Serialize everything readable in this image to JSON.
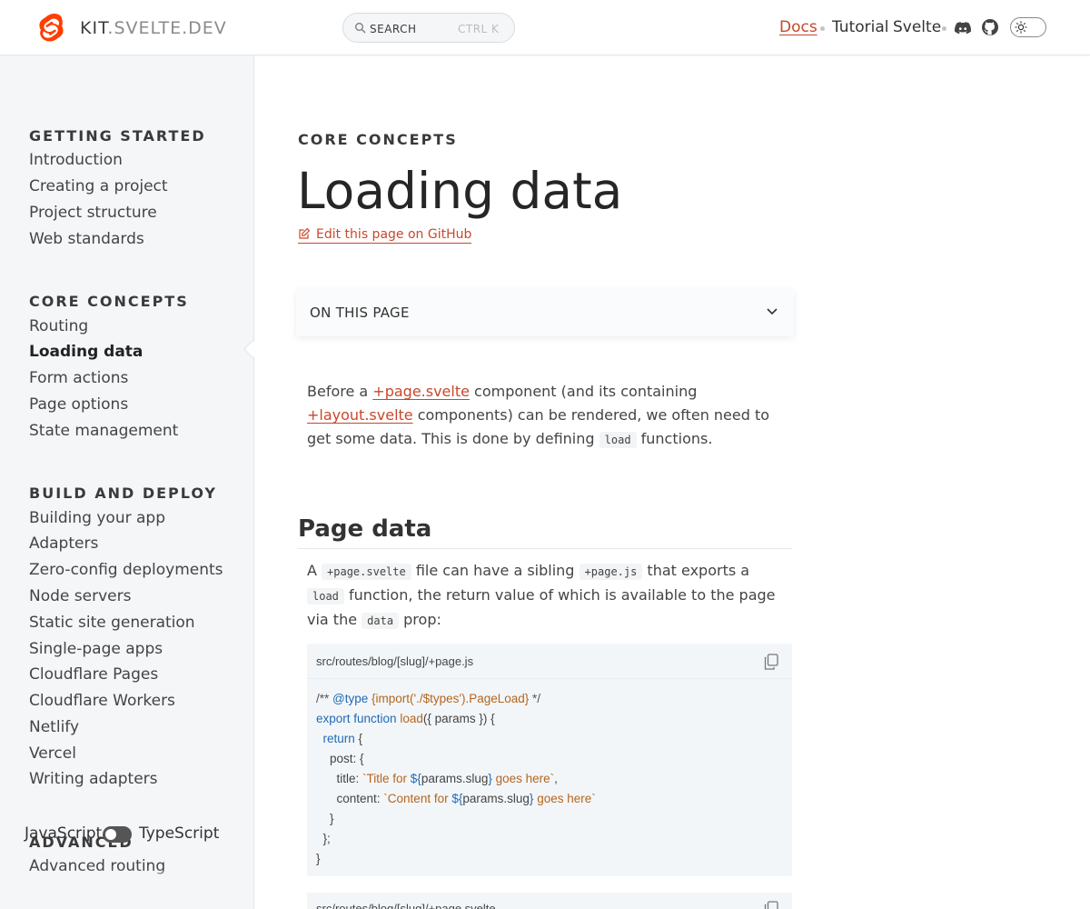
{
  "header": {
    "brand_main": "KIT",
    "brand_dim": ".SVELTE.DEV",
    "search_label": "SEARCH",
    "search_shortcut": "CTRL  K",
    "nav": [
      {
        "label": "Docs",
        "active": true
      },
      {
        "label": "Tutorial",
        "active": false
      },
      {
        "label": "Svelte",
        "active": false
      }
    ],
    "icons": [
      "discord-icon",
      "github-icon",
      "sun-icon"
    ],
    "accent_color": "#c9472a"
  },
  "sidebar": {
    "sections": [
      {
        "title": "GETTING STARTED",
        "items": [
          "Introduction",
          "Creating a project",
          "Project structure",
          "Web standards"
        ]
      },
      {
        "title": "CORE CONCEPTS",
        "items": [
          "Routing",
          "Loading data",
          "Form actions",
          "Page options",
          "State management"
        ]
      },
      {
        "title": "BUILD AND DEPLOY",
        "items": [
          "Building your app",
          "Adapters",
          "Zero-config deployments",
          "Node servers",
          "Static site generation",
          "Single-page apps",
          "Cloudflare Pages",
          "Cloudflare Workers",
          "Netlify",
          "Vercel",
          "Writing adapters"
        ]
      },
      {
        "title": "ADVANCED",
        "items": [
          "Advanced routing"
        ]
      }
    ],
    "active_item": "Loading data",
    "lang_left": "JavaScript",
    "lang_right": "TypeScript"
  },
  "main": {
    "kicker": "CORE CONCEPTS",
    "title": "Loading data",
    "edit_link": "Edit this page on GitHub",
    "on_this_page": "ON THIS PAGE",
    "intro": {
      "t1": "Before a ",
      "l1": "+page.svelte",
      "t2": " component (and its containing ",
      "l2": "+layout.svelte",
      "t3": " components) can be rendered, we often need to get some data. This is done by defining ",
      "c1": "load",
      "t4": " functions."
    },
    "h2": "Page data",
    "p2": {
      "t1": "A ",
      "c1": "+page.svelte",
      "t2": " file can have a sibling ",
      "c2": "+page.js",
      "t3": " that exports a ",
      "c3": "load",
      "t4": " function, the return value of which is available to the page via the ",
      "c4": "data",
      "t5": " prop:"
    },
    "code1": {
      "file": "src/routes/blog/[slug]/+page.js",
      "l1a": "/** ",
      "l1b": "@type",
      "l1c": " {import('./$types').PageLoad}",
      "l1d": " */",
      "l2a": "export function",
      "l2b": " load",
      "l2c": "({ params }) {",
      "l3a": "  return",
      "l3b": " {",
      "l4": "    post: {",
      "l5a": "      title: ",
      "l5b": "`Title for ",
      "l5c": "${",
      "l5d": "params.slug",
      "l5e": "}",
      "l5f": " goes here`",
      "l5g": ",",
      "l6a": "      content: ",
      "l6b": "`Content for ",
      "l6c": "${",
      "l6d": "params.slug",
      "l6e": "}",
      "l6f": " goes here`",
      "l7": "    }",
      "l8": "  };",
      "l9": "}"
    },
    "code2": {
      "file": "src/routes/blog/[slug]/+page.svelte"
    }
  }
}
